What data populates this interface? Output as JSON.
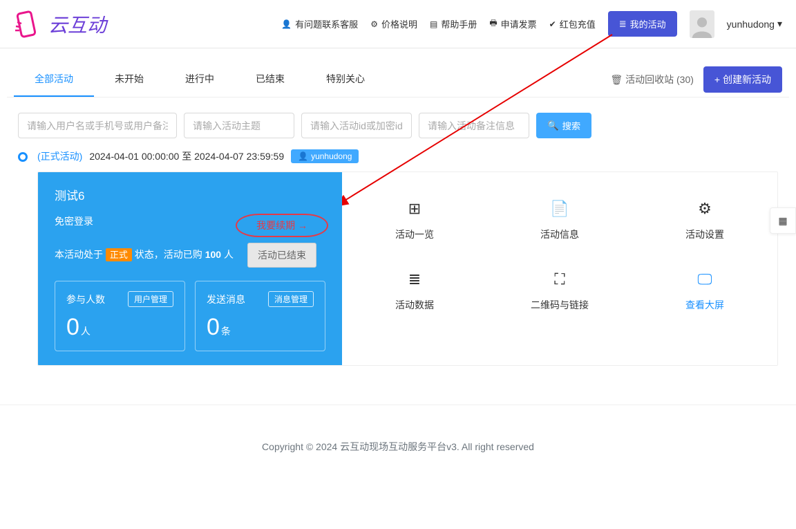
{
  "header": {
    "logo_text": "云互动",
    "nav": {
      "support": "有问题联系客服",
      "pricing": "价格说明",
      "help": "帮助手册",
      "invoice": "申请发票",
      "redpack": "红包充值",
      "my_activity": "我的活动"
    },
    "user_name": "yunhudong"
  },
  "tabs": {
    "all": "全部活动",
    "not_started": "未开始",
    "ongoing": "进行中",
    "ended": "已结束",
    "special": "特别关心",
    "recycle": "活动回收站 (30)",
    "create": "+ 创建新活动"
  },
  "search": {
    "ph_user": "请输入用户名或手机号或用户备注",
    "ph_theme": "请输入活动主题",
    "ph_id": "请输入活动id或加密id",
    "ph_remark": "请输入活动备注信息",
    "btn": "搜索"
  },
  "activity": {
    "type": "(正式活动)",
    "time": "2024-04-01 00:00:00 至 2024-04-07 23:59:59",
    "owner": "yunhudong",
    "title": "测试6",
    "subtitle": "免密登录",
    "renew": "我要续期",
    "ended_btn": "活动已结束",
    "status_prefix": "本活动处于",
    "status_badge": "正式",
    "status_mid": "状态，活动已购",
    "status_count": "100",
    "status_suffix": "人",
    "stat1": {
      "label": "参与人数",
      "chip": "用户管理",
      "value": "0",
      "unit": "人"
    },
    "stat2": {
      "label": "发送消息",
      "chip": "消息管理",
      "value": "0",
      "unit": "条"
    },
    "grid": {
      "overview": "活动一览",
      "info": "活动信息",
      "settings": "活动设置",
      "data": "活动数据",
      "qrcode": "二维码与链接",
      "screen": "查看大屏"
    }
  },
  "footer": "Copyright © 2024 云互动现场互动服务平台v3. All right reserved"
}
